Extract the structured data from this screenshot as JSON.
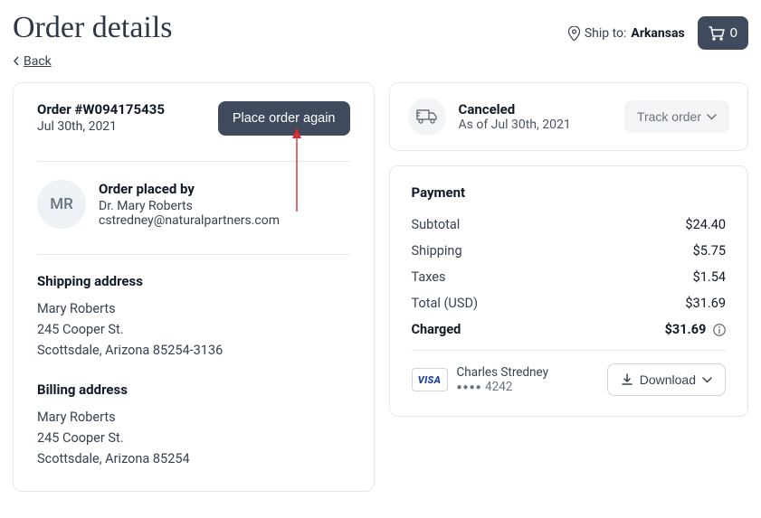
{
  "header": {
    "title": "Order details",
    "back_label": "Back",
    "ship_to_prefix": "Ship to:",
    "ship_to_location": "Arkansas",
    "cart_count": "0"
  },
  "order": {
    "number_label": "Order #W094175435",
    "date": "Jul 30th, 2021",
    "place_again_label": "Place order again",
    "placed_by": {
      "heading": "Order placed by",
      "initials": "MR",
      "name": "Dr. Mary Roberts",
      "email": "cstredney@naturalpartners.com"
    },
    "shipping": {
      "heading": "Shipping address",
      "name": "Mary Roberts",
      "line1": "245 Cooper St.",
      "line2": "Scottsdale, Arizona 85254-3136"
    },
    "billing": {
      "heading": "Billing address",
      "name": "Mary Roberts",
      "line1": "245 Cooper St.",
      "line2": "Scottsdale, Arizona 85254"
    }
  },
  "status": {
    "title": "Canceled",
    "subtitle": "As of Jul 30th, 2021",
    "track_label": "Track order"
  },
  "payment": {
    "heading": "Payment",
    "rows": {
      "subtotal_label": "Subtotal",
      "subtotal_value": "$24.40",
      "shipping_label": "Shipping",
      "shipping_value": "$5.75",
      "taxes_label": "Taxes",
      "taxes_value": "$1.54",
      "total_label": "Total (USD)",
      "total_value": "$31.69",
      "charged_label": "Charged",
      "charged_value": "$31.69"
    },
    "card": {
      "brand": "VISA",
      "holder": "Charles Stredney",
      "last4": "4242"
    },
    "download_label": "Download"
  }
}
